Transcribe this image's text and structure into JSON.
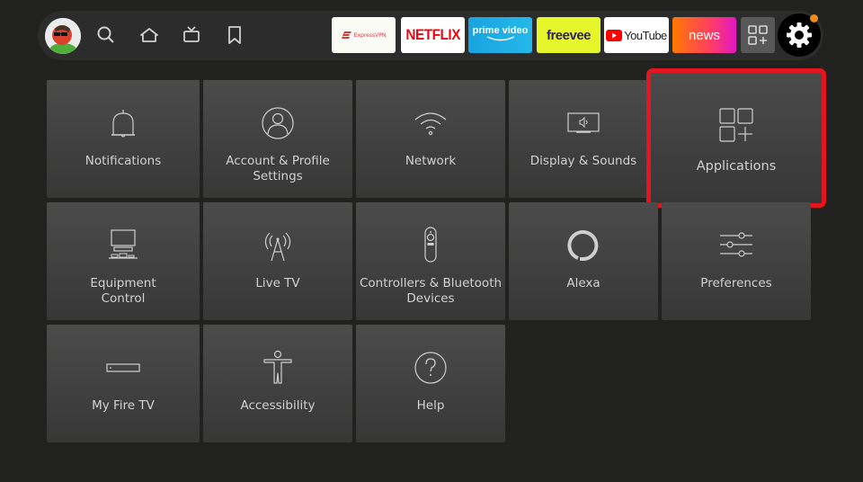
{
  "header": {
    "profile": {
      "name": "profile-avatar"
    },
    "nav": [
      {
        "id": "search",
        "icon": "search-icon"
      },
      {
        "id": "home",
        "icon": "home-icon"
      },
      {
        "id": "live",
        "icon": "tv-icon"
      },
      {
        "id": "watchlist",
        "icon": "bookmark-icon"
      }
    ],
    "apps": [
      {
        "id": "expressvpn",
        "label": "ExpressVPN",
        "bg": "#fbfbf6",
        "color": "#da3940"
      },
      {
        "id": "netflix",
        "label": "NETFLIX",
        "bg": "#ffffff",
        "color": "#e50914"
      },
      {
        "id": "prime-video",
        "label": "prime video",
        "bg": "#1ea7e1",
        "color": "#ffffff"
      },
      {
        "id": "freevee",
        "label": "freevee",
        "bg": "#e5f72b",
        "color": "#2e1f5e"
      },
      {
        "id": "youtube",
        "label": "YouTube",
        "bg": "#ffffff",
        "color": "#212121"
      },
      {
        "id": "news",
        "label": "news",
        "bg": "#ff6f0f",
        "color": "#ffffff"
      }
    ],
    "all_apps_icon": "apps-grid-icon",
    "settings_icon": "gear-icon",
    "notification_color": "#f08a1c"
  },
  "settings": {
    "focused": "Applications",
    "focus_color": "#e3161f",
    "tiles": [
      {
        "label": "Notifications",
        "icon": "bell-icon"
      },
      {
        "label": "Account & Profile\nSettings",
        "icon": "user-circle-icon"
      },
      {
        "label": "Network",
        "icon": "wifi-icon"
      },
      {
        "label": "Display & Sounds",
        "icon": "display-sound-icon"
      },
      {
        "label": "Applications",
        "icon": "apps-add-icon"
      },
      {
        "label": "Equipment\nControl",
        "icon": "equipment-icon"
      },
      {
        "label": "Live TV",
        "icon": "antenna-icon"
      },
      {
        "label": "Controllers & Bluetooth\nDevices",
        "icon": "remote-icon"
      },
      {
        "label": "Alexa",
        "icon": "alexa-icon"
      },
      {
        "label": "Preferences",
        "icon": "sliders-icon"
      },
      {
        "label": "My Fire TV",
        "icon": "fire-tv-device-icon"
      },
      {
        "label": "Accessibility",
        "icon": "accessibility-icon"
      },
      {
        "label": "Help",
        "icon": "help-icon"
      }
    ]
  }
}
